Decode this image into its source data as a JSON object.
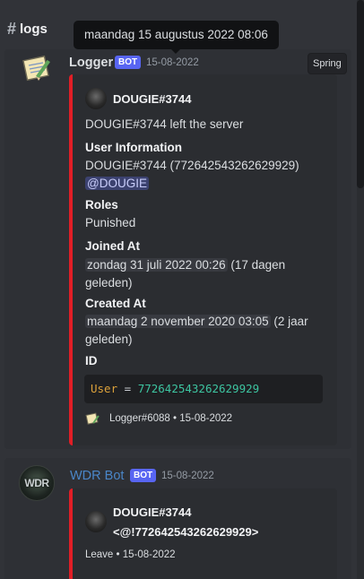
{
  "channel": {
    "hash": "#",
    "name": "logs"
  },
  "tooltip": {
    "text": "maandag 15 augustus 2022 08:06"
  },
  "message1": {
    "author": "Logger",
    "author_color": "#dbdee1",
    "bot_tag": "BOT",
    "timestamp": "15-08-2022",
    "reaction_label": "Spring",
    "embed": {
      "border_color": "#e11e26",
      "author_name": "DOUGIE#3744",
      "description": "DOUGIE#3744 left the server",
      "fields": [
        {
          "name": "User Information",
          "line1": "DOUGIE#3744 (772642543262629929)",
          "mention": "@DOUGIE"
        },
        {
          "name": "Roles",
          "value": "Punished"
        },
        {
          "name": "Joined At",
          "stamp": "zondag 31 juli 2022 00:26",
          "relative_a": " (17 dagen",
          "relative_b": "geleden)"
        },
        {
          "name": "Created At",
          "stamp": "maandag 2 november 2020 03:05",
          "relative_a": " (2 jaar",
          "relative_b": "geleden)"
        },
        {
          "name": "ID"
        }
      ],
      "code": {
        "key": "User",
        "eq": "=",
        "value": "772642543262629929"
      },
      "footer": "Logger#6088 • 15-08-2022"
    }
  },
  "message2": {
    "author": "WDR Bot",
    "author_color": "#4a86c8",
    "avatar_text": "WDR",
    "bot_tag": "BOT",
    "timestamp": "15-08-2022",
    "embed": {
      "author_name": "DOUGIE#3744",
      "author_line2": "<@!772642543262629929>",
      "footer": "Leave • 15-08-2022"
    }
  }
}
